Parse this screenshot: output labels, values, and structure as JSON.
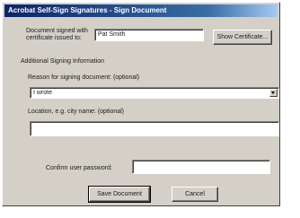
{
  "window": {
    "title": "Acrobat Self-Sign Signatures - Sign Document"
  },
  "signer": {
    "label_line1": "Document signed with",
    "label_line2": "certificate issued to:",
    "value": "Pat Smith",
    "show_certificate_button": "Show Certificate..."
  },
  "additional": {
    "section_label": "Additional Signing Information",
    "reason_label": "Reason for signing document: (optional)",
    "reason_value": "I wrote",
    "location_label": "Location, e.g. city name: (optional)",
    "location_value": ""
  },
  "password": {
    "label": "Confirm user password:",
    "value": ""
  },
  "buttons": {
    "save": "Save Document",
    "cancel": "Cancel"
  }
}
